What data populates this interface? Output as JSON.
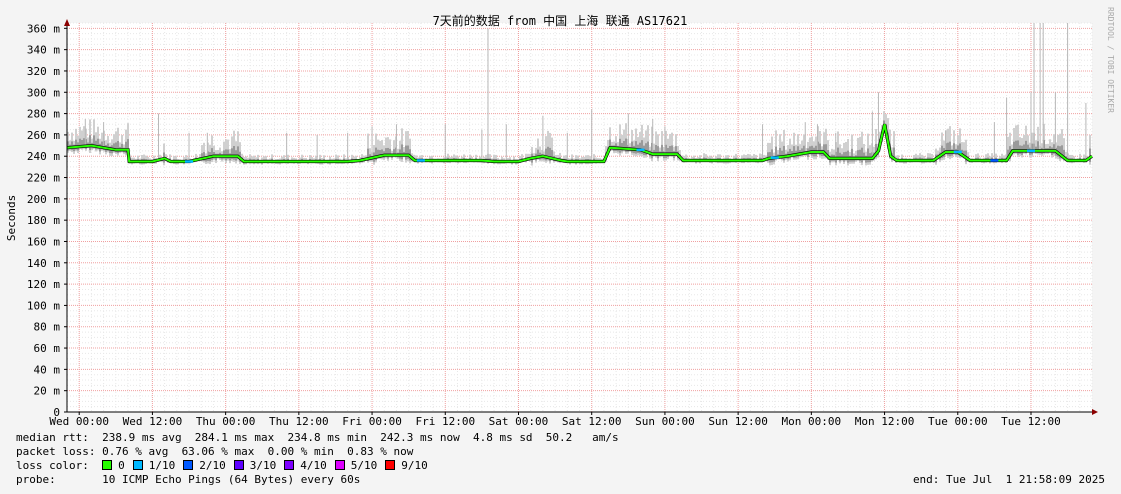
{
  "chart_data": {
    "type": "line",
    "title": "7天前的数据 from 中国 上海 联通 AS17621",
    "ylabel": "Seconds",
    "watermark": "RRDTOOL / TOBI OETIKER",
    "ylim": [
      0,
      365
    ],
    "y_ticks": [
      "0",
      "20 m",
      "40 m",
      "60 m",
      "80 m",
      "100 m",
      "120 m",
      "140 m",
      "160 m",
      "180 m",
      "200 m",
      "220 m",
      "240 m",
      "260 m",
      "280 m",
      "300 m",
      "320 m",
      "340 m",
      "360 m"
    ],
    "x_ticks": [
      "Wed 00:00",
      "Wed 12:00",
      "Thu 00:00",
      "Thu 12:00",
      "Fri 00:00",
      "Fri 12:00",
      "Sat 00:00",
      "Sat 12:00",
      "Sun 00:00",
      "Sun 12:00",
      "Mon 00:00",
      "Mon 12:00",
      "Tue 00:00",
      "Tue 12:00"
    ],
    "x_unit": "hours since Wed 00:00",
    "x_range_hours": [
      -2,
      166
    ],
    "grid": true,
    "series": [
      {
        "name": "median rtt",
        "values_ms": [
          [
            -2,
            248
          ],
          [
            2,
            250
          ],
          [
            6,
            246
          ],
          [
            8,
            246
          ],
          [
            8.2,
            235
          ],
          [
            12,
            235
          ],
          [
            14,
            238
          ],
          [
            15,
            235
          ],
          [
            18,
            235
          ],
          [
            22,
            240
          ],
          [
            26,
            240
          ],
          [
            27,
            235
          ],
          [
            36,
            235
          ],
          [
            44,
            235
          ],
          [
            46,
            236
          ],
          [
            50,
            241
          ],
          [
            54,
            241
          ],
          [
            55,
            236
          ],
          [
            62,
            236
          ],
          [
            66,
            236
          ],
          [
            68,
            235
          ],
          [
            72,
            235
          ],
          [
            74,
            238
          ],
          [
            76,
            240
          ],
          [
            79,
            236
          ],
          [
            80,
            235
          ],
          [
            86,
            235
          ],
          [
            87,
            248
          ],
          [
            92,
            246
          ],
          [
            94,
            242
          ],
          [
            98,
            242
          ],
          [
            99,
            236
          ],
          [
            110,
            236
          ],
          [
            112,
            236
          ],
          [
            113,
            238
          ],
          [
            116,
            240
          ],
          [
            118,
            242
          ],
          [
            120,
            244
          ],
          [
            122,
            244
          ],
          [
            123,
            238
          ],
          [
            130,
            238
          ],
          [
            131,
            245
          ],
          [
            132,
            270
          ],
          [
            133,
            240
          ],
          [
            134,
            236
          ],
          [
            140,
            236
          ],
          [
            142,
            244
          ],
          [
            144,
            244
          ],
          [
            146,
            236
          ],
          [
            152,
            236
          ],
          [
            153,
            245
          ],
          [
            160,
            245
          ],
          [
            162,
            236
          ],
          [
            165,
            236
          ],
          [
            166,
            240
          ]
        ]
      }
    ],
    "spikes_ms": [
      [
        1,
        275
      ],
      [
        4,
        272
      ],
      [
        13,
        280
      ],
      [
        18,
        262
      ],
      [
        21,
        262
      ],
      [
        34,
        262
      ],
      [
        39,
        260
      ],
      [
        44,
        262
      ],
      [
        48,
        268
      ],
      [
        52,
        270
      ],
      [
        60,
        270
      ],
      [
        66,
        265
      ],
      [
        67,
        360
      ],
      [
        70,
        270
      ],
      [
        76,
        278
      ],
      [
        80,
        262
      ],
      [
        84,
        284
      ],
      [
        90,
        280
      ],
      [
        94,
        275
      ],
      [
        96,
        268
      ],
      [
        112,
        270
      ],
      [
        119,
        272
      ],
      [
        121,
        270
      ],
      [
        124,
        262
      ],
      [
        130,
        282
      ],
      [
        131,
        300
      ],
      [
        142,
        264
      ],
      [
        150,
        272
      ],
      [
        152,
        295
      ],
      [
        156,
        300
      ],
      [
        156.5,
        365
      ],
      [
        157.5,
        365
      ],
      [
        158,
        365
      ],
      [
        160,
        300
      ],
      [
        162,
        365
      ],
      [
        165,
        290
      ]
    ]
  },
  "stats": {
    "median_rtt": "median rtt:  238.9 ms avg  284.1 ms max  234.8 ms min  242.3 ms now  4.8 ms sd  50.2   am/s",
    "packet_loss": "packet loss: 0.76 % avg  63.06 % max  0.00 % min  0.83 % now",
    "loss_color_label": "loss color:",
    "probe": "probe:       10 ICMP Echo Pings (64 Bytes) every 60s",
    "end": "end: Tue Jul  1 21:58:09 2025"
  },
  "loss_colors": [
    {
      "label": "0",
      "color": "#26ff00"
    },
    {
      "label": "1/10",
      "color": "#00b8ff"
    },
    {
      "label": "2/10",
      "color": "#0059ff"
    },
    {
      "label": "3/10",
      "color": "#5e00ff"
    },
    {
      "label": "4/10",
      "color": "#7e00ff"
    },
    {
      "label": "5/10",
      "color": "#dd00ff"
    },
    {
      "label": "9/10",
      "color": "#ff0000"
    }
  ]
}
